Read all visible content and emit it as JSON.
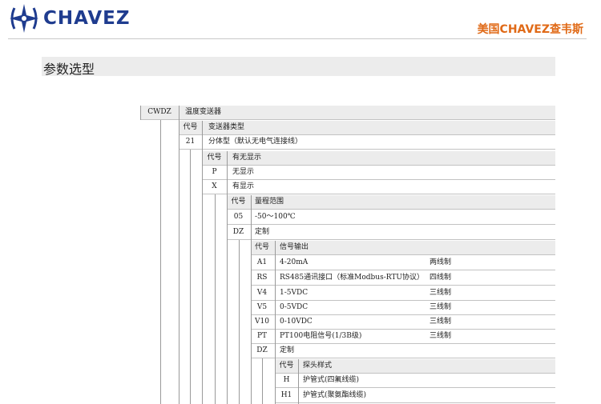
{
  "header": {
    "logo_text": "CHAVEZ",
    "brand_cn": "美国CHAVEZ查韦斯",
    "logo_icon": "compass-star-icon"
  },
  "section": {
    "title": "参数选型"
  },
  "colors": {
    "brand_blue": "#1f3c8f",
    "brand_orange": "#e06a17",
    "header_gray": "#ececec"
  },
  "table": {
    "model": {
      "code": "CWDZ",
      "desc": "温度变送器"
    },
    "groups": [
      {
        "header": {
          "code": "代号",
          "desc": "变送器类型"
        },
        "rows": [
          {
            "code": "21",
            "desc": "分体型（默认无电气连接线）"
          }
        ]
      },
      {
        "header": {
          "code": "代号",
          "desc": "有无显示"
        },
        "rows": [
          {
            "code": "P",
            "desc": "无显示"
          },
          {
            "code": "X",
            "desc": "有显示"
          }
        ]
      },
      {
        "header": {
          "code": "代号",
          "desc": "量程范围"
        },
        "rows": [
          {
            "code": "05",
            "desc": "-50～100℃"
          },
          {
            "code": "DZ",
            "desc": "定制"
          }
        ]
      },
      {
        "header": {
          "code": "代号",
          "desc": "信号输出"
        },
        "rows": [
          {
            "code": "A1",
            "desc": "4-20mA",
            "note": "两线制"
          },
          {
            "code": "RS",
            "desc": "RS485通讯接口（标准Modbus-RTU协议）",
            "note": "四线制"
          },
          {
            "code": "V4",
            "desc": "1-5VDC",
            "note": "三线制"
          },
          {
            "code": "V5",
            "desc": "0-5VDC",
            "note": "三线制"
          },
          {
            "code": "V10",
            "desc": "0-10VDC",
            "note": "三线制"
          },
          {
            "code": "PT",
            "desc": "PT100电阻信号(1/3B级)",
            "note": "三线制"
          },
          {
            "code": "DZ",
            "desc": "定制"
          }
        ]
      },
      {
        "header": {
          "code": "代号",
          "desc": "探头样式"
        },
        "rows": [
          {
            "code": "H",
            "desc": "护管式(四氟线缆)"
          },
          {
            "code": "H1",
            "desc": "护管式(聚氨酯线缆)"
          }
        ]
      }
    ]
  }
}
